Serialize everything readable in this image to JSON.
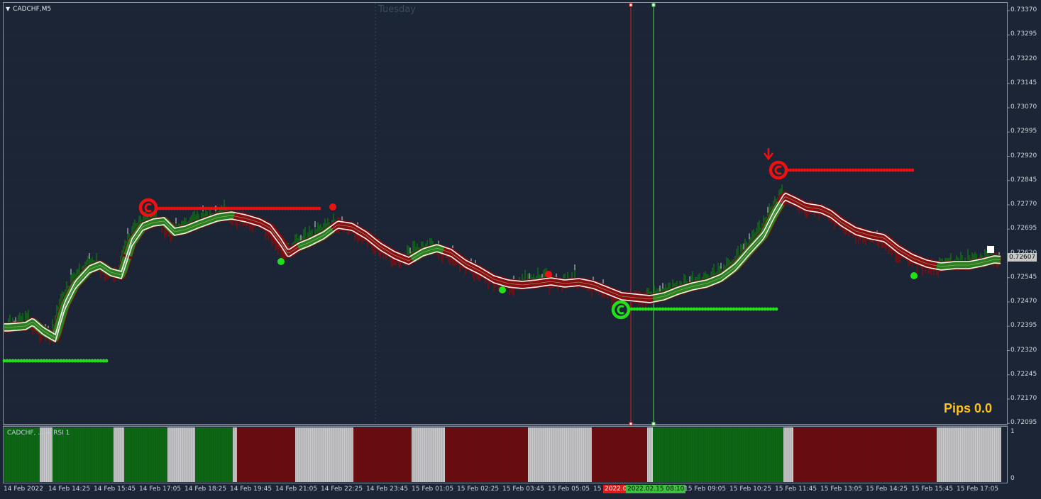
{
  "window": {
    "symbol_title": "CADCHF,M5",
    "day_label": "Tuesday"
  },
  "price_axis": {
    "labels": [
      "0.73370",
      "0.73295",
      "0.73220",
      "0.73145",
      "0.73070",
      "0.72995",
      "0.72920",
      "0.72845",
      "0.72770",
      "0.72695",
      "0.72620",
      "0.72545",
      "0.72470",
      "0.72395",
      "0.72320",
      "0.72245",
      "0.72170",
      "0.72095"
    ],
    "current_price": "0.72607"
  },
  "time_axis": {
    "labels": [
      "14 Feb 2022",
      "14 Feb 14:25",
      "14 Feb 15:45",
      "14 Feb 17:05",
      "14 Feb 18:25",
      "14 Feb 19:45",
      "14 Feb 21:05",
      "14 Feb 22:25",
      "14 Feb 23:45",
      "15 Feb 01:05",
      "15 Feb 02:25",
      "15 Feb 03:45",
      "15 Feb 05:05",
      "15",
      "15 Feb 09:05",
      "15 Feb 10:25",
      "15 Feb 11:45",
      "15 Feb 13:05",
      "15 Feb 14:25",
      "15 Feb 15:45",
      "15 Feb 17:05"
    ],
    "cursor_red_label": "2022.0",
    "cursor_green_label": "2022.02.15 08:10"
  },
  "info": {
    "pips_text": "Pips 0.0"
  },
  "subwindow": {
    "title": "CADCHF, ... + RSI 1",
    "scale_top": "1",
    "scale_bottom": "0"
  },
  "colors": {
    "background": "#1b2535",
    "bull": "#0c6a12",
    "bear": "#6e0c0f",
    "neutral": "#c8c8c8",
    "signal_green": "#22e01a",
    "signal_red": "#ee1111",
    "pips": "#ffc21a",
    "cursor_red": "#e01b1b",
    "cursor_green": "#52d652"
  },
  "icons": [
    "dropdown-triangle-icon",
    "sell-arrow-icon",
    "buy-signal-icon",
    "sell-signal-icon",
    "stop-square-icon"
  ]
}
